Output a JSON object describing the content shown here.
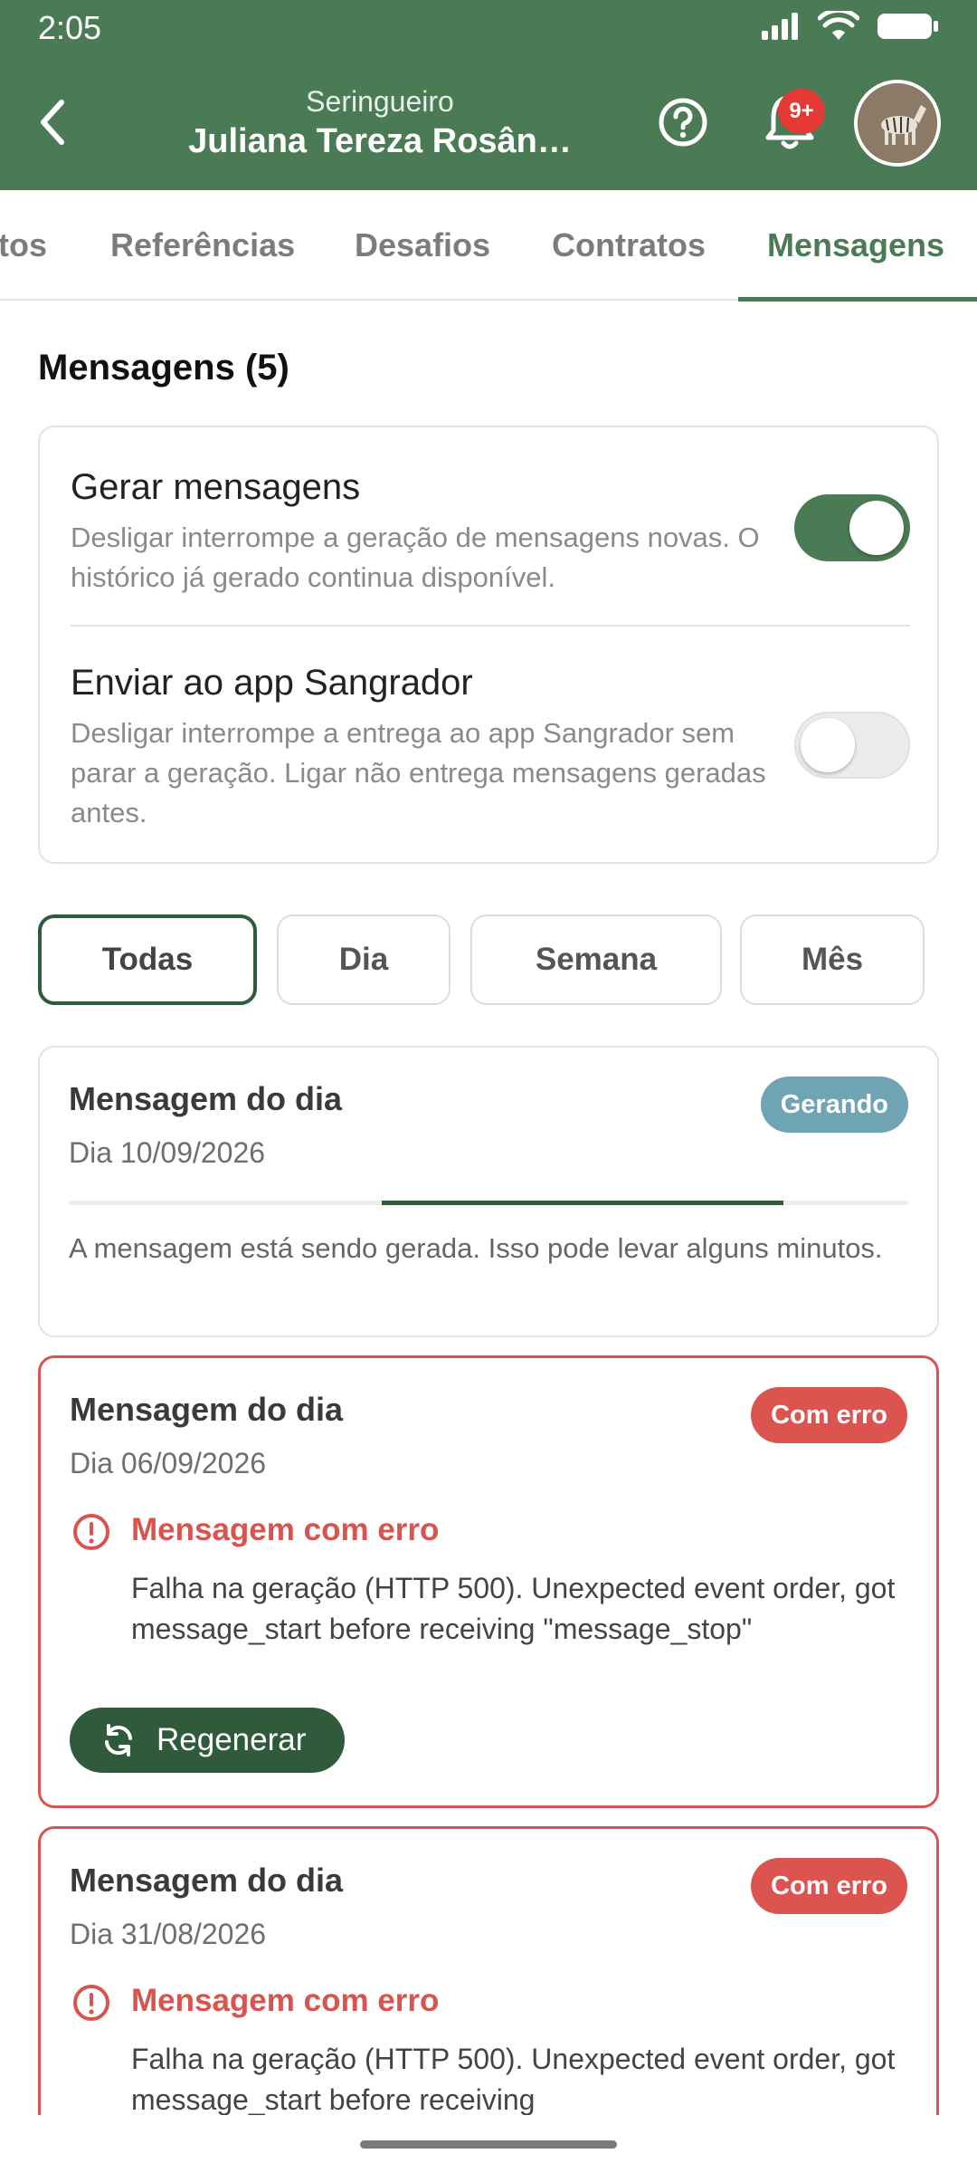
{
  "status_bar": {
    "time": "2:05"
  },
  "header": {
    "subtitle": "Seringueiro",
    "title": "Juliana Tereza Rosân…",
    "notification_badge": "9+"
  },
  "tabs": [
    {
      "label": "tos"
    },
    {
      "label": "Referências"
    },
    {
      "label": "Desafios"
    },
    {
      "label": "Contratos"
    },
    {
      "label": "Mensagens",
      "active": true
    }
  ],
  "section": {
    "title": "Mensagens (5)"
  },
  "settings": {
    "generate": {
      "title": "Gerar mensagens",
      "description": "Desligar interrompe a geração de mensagens novas. O histórico já gerado continua disponível.",
      "enabled": true
    },
    "send": {
      "title": "Enviar ao app Sangrador",
      "description": "Desligar interrompe a entrega ao app Sangrador sem parar a geração. Ligar não entrega mensagens geradas antes.",
      "enabled": false
    }
  },
  "filters": [
    {
      "label": "Todas",
      "active": true
    },
    {
      "label": "Dia"
    },
    {
      "label": "Semana"
    },
    {
      "label": "Mês"
    }
  ],
  "messages": [
    {
      "title": "Mensagem do dia",
      "date": "Dia 10/09/2026",
      "status": "Gerando",
      "text": "A mensagem está sendo gerada. Isso pode levar alguns minutos."
    },
    {
      "title": "Mensagem do dia",
      "date": "Dia 06/09/2026",
      "status": "Com erro",
      "error_title": "Mensagem com erro",
      "error_text": "Falha na geração (HTTP 500). Unexpected event order, got message_start before receiving \"message_stop\"",
      "action": "Regenerar"
    },
    {
      "title": "Mensagem do dia",
      "date": "Dia 31/08/2026",
      "status": "Com erro",
      "error_title": "Mensagem com erro",
      "error_text": "Falha na geração (HTTP 500). Unexpected event order, got message_start before receiving"
    }
  ],
  "colors": {
    "primary": "#4a7b54",
    "primary_dark": "#2f5b3b",
    "error": "#d9534f",
    "generating": "#6ea4b3"
  }
}
